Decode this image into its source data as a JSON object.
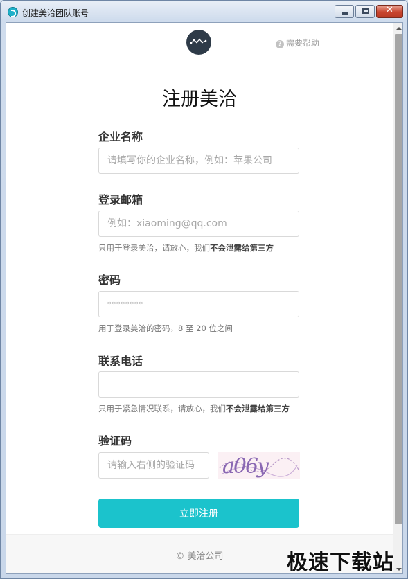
{
  "window": {
    "title": "创建美洽团队账号"
  },
  "header": {
    "help_label": "需要帮助",
    "help_icon_glyph": "?"
  },
  "form": {
    "title": "注册美洽",
    "company": {
      "label": "企业名称",
      "placeholder": "请填写你的企业名称，例如：苹果公司"
    },
    "email": {
      "label": "登录邮箱",
      "placeholder": "例如：xiaoming@qq.com",
      "hint_prefix": "只用于登录美洽，请放心，我们",
      "hint_bold": "不会泄露给第三方"
    },
    "password": {
      "label": "密码",
      "placeholder": "********",
      "hint": "用于登录美洽的密码，8 至 20 位之间"
    },
    "phone": {
      "label": "联系电话",
      "placeholder": "",
      "hint_prefix": "只用于紧急情况联系，请放心，我们",
      "hint_bold": "不会泄露给第三方"
    },
    "captcha": {
      "label": "验证码",
      "placeholder": "请输入右侧的验证码",
      "image_text": "a06y"
    },
    "submit_label": "立即注册"
  },
  "footer": {
    "text": "© 美洽公司"
  },
  "watermark": {
    "text": "极速下载站"
  },
  "colors": {
    "accent": "#1bc3cc",
    "logo_bg": "#2e3b48"
  }
}
